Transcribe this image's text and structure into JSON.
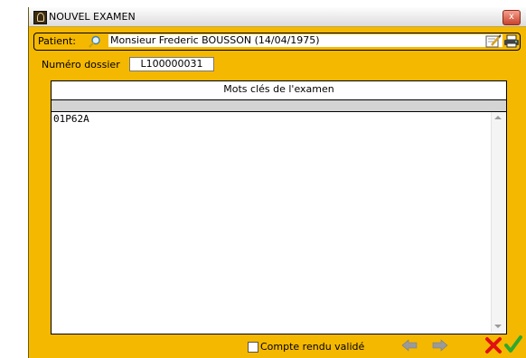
{
  "window": {
    "title": "NOUVEL EXAMEN",
    "close_glyph": "x"
  },
  "patient": {
    "label": "Patient:",
    "value": "Monsieur Frederic BOUSSON (14/04/1975)"
  },
  "dossier": {
    "label": "Numéro dossier",
    "value": "L100000031"
  },
  "keywords": {
    "header": "Mots clés de l'examen",
    "text": "01P62A"
  },
  "footer": {
    "validated_label": "Compte rendu validé",
    "validated_checked": false
  },
  "icons": [
    "app-icon",
    "search-icon",
    "edit-icon",
    "printer-icon",
    "prev-arrow-icon",
    "next-arrow-icon",
    "cancel-icon",
    "ok-check-icon"
  ],
  "colors": {
    "window_background": "#f5b800",
    "cancel": "#e01010",
    "ok": "#2ea82e"
  }
}
